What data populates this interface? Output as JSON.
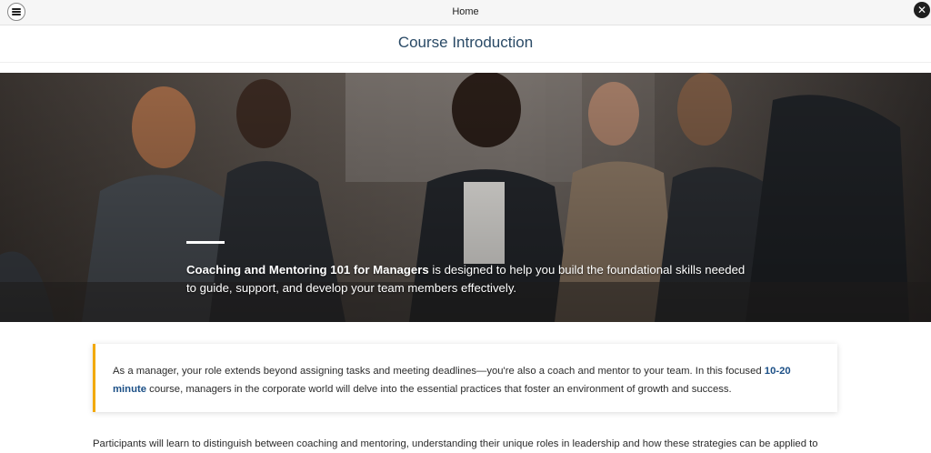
{
  "topbar": {
    "title": "Home",
    "menu_icon": "hamburger-menu-icon",
    "close_icon": "close-icon",
    "close_glyph": "✕"
  },
  "page": {
    "title": "Course Introduction"
  },
  "hero": {
    "course_name": "Coaching and Mentoring 101 for Managers",
    "description": " is designed to help you build the foundational skills needed to guide, support, and develop your team members effectively."
  },
  "callout": {
    "text_before": "As a manager, your role extends beyond assigning tasks and meeting deadlines—you're also a coach and mentor to your team. In this focused ",
    "highlight": "10-20 minute",
    "text_after": " course, managers in the corporate world will delve into the essential practices that foster an environment of growth and success.",
    "accent_color": "#f2a900"
  },
  "next_paragraph": "Participants will learn to distinguish between coaching and mentoring, understanding their unique roles in leadership and how these strategies can be applied to"
}
